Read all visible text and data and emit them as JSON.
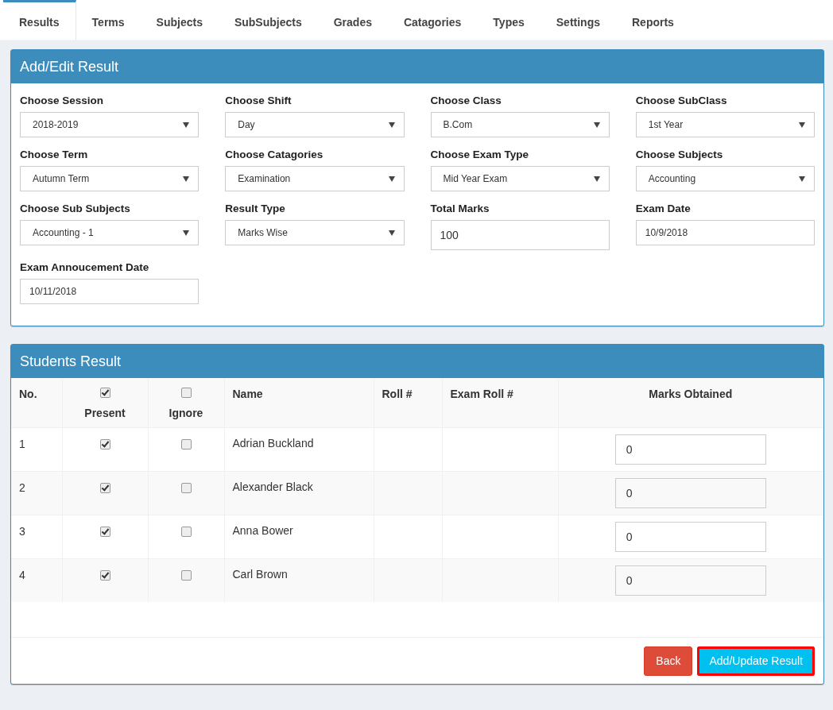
{
  "tabs": [
    {
      "label": "Results",
      "selected": true
    },
    {
      "label": "Terms",
      "selected": false
    },
    {
      "label": "Subjects",
      "selected": false
    },
    {
      "label": "SubSubjects",
      "selected": false
    },
    {
      "label": "Grades",
      "selected": false
    },
    {
      "label": "Catagories",
      "selected": false
    },
    {
      "label": "Types",
      "selected": false
    },
    {
      "label": "Settings",
      "selected": false
    },
    {
      "label": "Reports",
      "selected": false
    }
  ],
  "form_panel": {
    "title": "Add/Edit Result",
    "fields": [
      {
        "label": "Choose Session",
        "kind": "select",
        "value": "2018-2019"
      },
      {
        "label": "Choose Shift",
        "kind": "select",
        "value": "Day"
      },
      {
        "label": "Choose Class",
        "kind": "select",
        "value": "B.Com"
      },
      {
        "label": "Choose SubClass",
        "kind": "select",
        "value": "1st Year"
      },
      {
        "label": "Choose Term",
        "kind": "select",
        "value": "Autumn Term"
      },
      {
        "label": "Choose Catagories",
        "kind": "select",
        "value": "Examination"
      },
      {
        "label": "Choose Exam Type",
        "kind": "select",
        "value": "Mid Year Exam"
      },
      {
        "label": "Choose Subjects",
        "kind": "select",
        "value": "Accounting"
      },
      {
        "label": "Choose Sub Subjects",
        "kind": "select",
        "value": "Accounting - 1"
      },
      {
        "label": "Result Type",
        "kind": "select",
        "value": "Marks Wise"
      },
      {
        "label": "Total Marks",
        "kind": "input",
        "value": "100"
      },
      {
        "label": "Exam Date",
        "kind": "date",
        "value": "10/9/2018"
      },
      {
        "label": "Exam Annoucement Date",
        "kind": "date",
        "value": "10/11/2018"
      }
    ]
  },
  "results_panel": {
    "title": "Students Result",
    "columns": {
      "no": "No.",
      "present": {
        "label": "Present",
        "checked": true
      },
      "ignore": {
        "label": "Ignore",
        "checked": false
      },
      "name": "Name",
      "roll": "Roll #",
      "exam_roll": "Exam Roll #",
      "marks": "Marks Obtained"
    },
    "rows": [
      {
        "no": "1",
        "present": true,
        "ignore": false,
        "name": "Adrian Buckland",
        "marks": "0"
      },
      {
        "no": "2",
        "present": true,
        "ignore": false,
        "name": "Alexander Black",
        "marks": "0"
      },
      {
        "no": "3",
        "present": true,
        "ignore": false,
        "name": "Anna Bower",
        "marks": "0"
      },
      {
        "no": "4",
        "present": true,
        "ignore": false,
        "name": "Carl Brown",
        "marks": "0"
      }
    ],
    "buttons": [
      {
        "label": "Back",
        "kind": "danger",
        "highlighted": false
      },
      {
        "label": "Add/Update Result",
        "kind": "info",
        "highlighted": true
      }
    ]
  }
}
